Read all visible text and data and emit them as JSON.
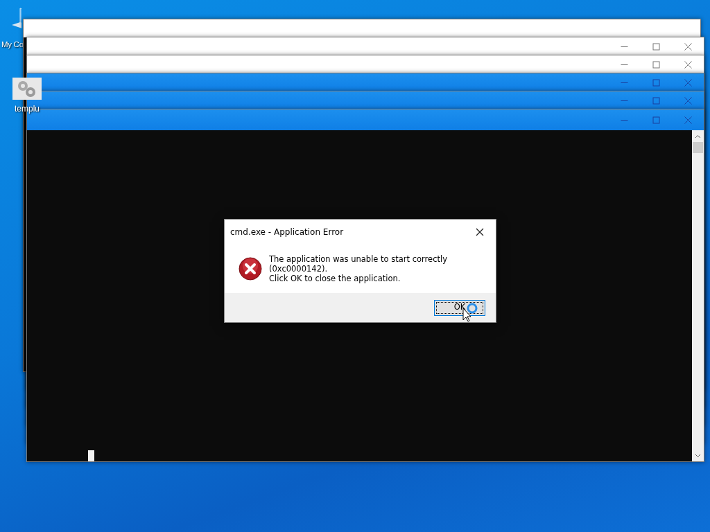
{
  "desktop_icons": [
    {
      "label": "My Co"
    },
    {
      "label": "templu"
    }
  ],
  "windows": [
    {
      "active": false,
      "controls": false
    },
    {
      "active": false,
      "controls": true
    },
    {
      "active": false,
      "controls": true
    },
    {
      "active": true,
      "controls": true
    },
    {
      "active": true,
      "controls": true
    },
    {
      "active": true,
      "controls": true
    }
  ],
  "dialog": {
    "title": "cmd.exe - Application Error",
    "message": [
      "The application was unable to start correctly (0xc0000142).",
      "Click OK to close the application."
    ],
    "button": {
      "label": "OK",
      "focused": true
    }
  }
}
